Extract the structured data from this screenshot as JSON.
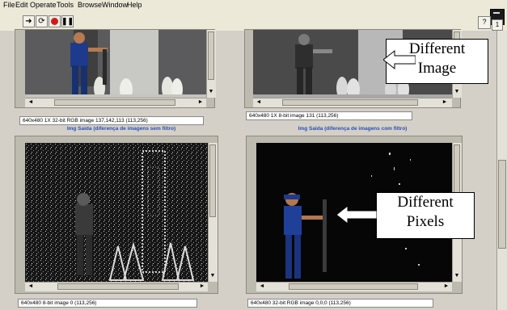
{
  "menu": [
    "File",
    "Edit",
    "Operate",
    "Tools",
    "Browse",
    "Window",
    "Help"
  ],
  "toolbar": {
    "run_icon": "arrow-run-icon",
    "run_continuous_icon": "run-continuously-icon",
    "abort_icon": "abort-icon",
    "pause_icon": "pause-icon",
    "help_label": "?",
    "corner_badge": "1"
  },
  "images": [
    {
      "info": "640x480 1X 32-bit RGB image 137,142,113     (113,256)",
      "caption": ""
    },
    {
      "info": "640x480 1X 8-bit image 131    (113,256)",
      "caption": ""
    },
    {
      "info": "640x480 8-bit image 0    (113,256)",
      "caption": "Img Saida (diferença de imagens sem filtro)"
    },
    {
      "info": "640x480 32-bit RGB image 0,0,0     (113,256)",
      "caption": "Img Saida (diferença de imagens com filtro)"
    }
  ],
  "callouts": {
    "image": {
      "line1": "Different",
      "line2": "Image"
    },
    "pixels": {
      "line1": "Different",
      "line2": "Pixels"
    }
  },
  "colors": {
    "caption_blue": "#2a4fb0",
    "abort_red": "#d81818"
  }
}
